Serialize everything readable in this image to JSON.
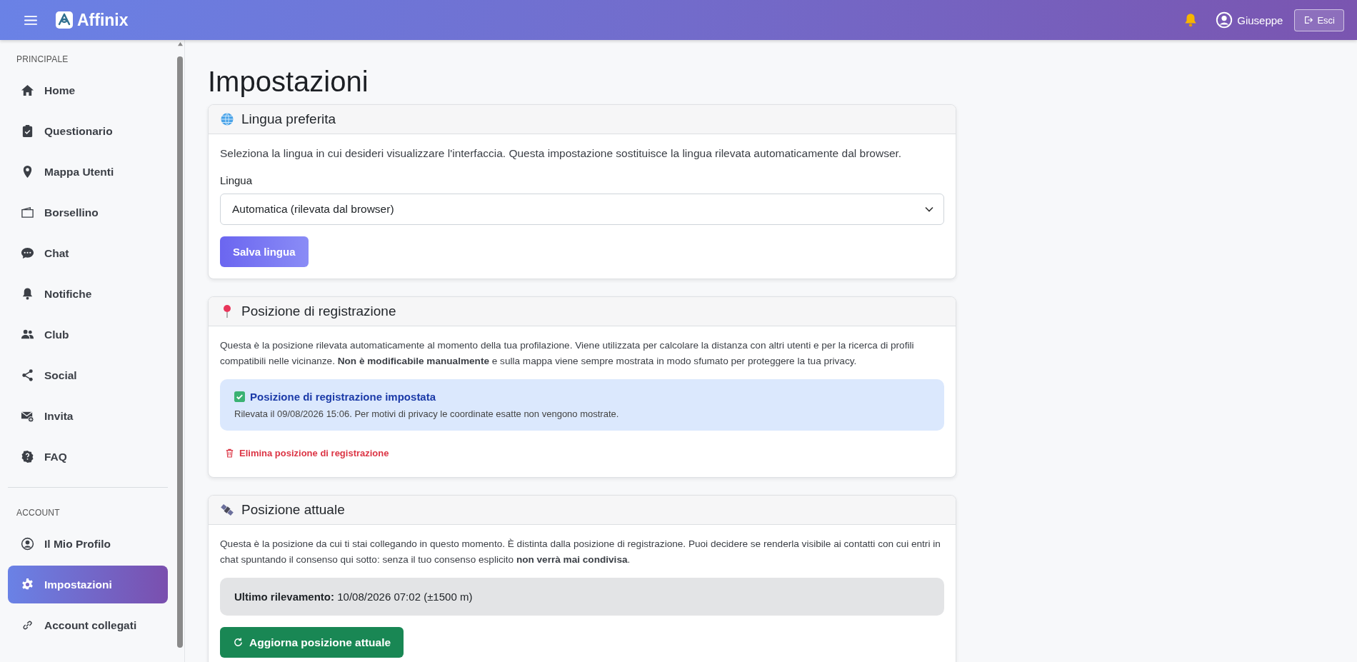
{
  "header": {
    "brand": "Affinix",
    "user": "Giuseppe",
    "logout": "Esci"
  },
  "sidebar": {
    "sections": [
      {
        "title": "PRINCIPALE",
        "items": [
          {
            "label": "Home",
            "selected": false
          },
          {
            "label": "Questionario",
            "selected": false
          },
          {
            "label": "Mappa Utenti",
            "selected": false
          },
          {
            "label": "Borsellino",
            "selected": false
          },
          {
            "label": "Chat",
            "selected": false
          },
          {
            "label": "Notifiche",
            "selected": false
          },
          {
            "label": "Club",
            "selected": false
          },
          {
            "label": "Social",
            "selected": false
          },
          {
            "label": "Invita",
            "selected": false
          },
          {
            "label": "FAQ",
            "selected": false
          }
        ]
      },
      {
        "title": "ACCOUNT",
        "items": [
          {
            "label": "Il Mio Profilo",
            "selected": false
          },
          {
            "label": "Impostazioni",
            "selected": true
          },
          {
            "label": "Account collegati",
            "selected": false
          }
        ]
      }
    ]
  },
  "page_title": "Impostazioni",
  "language_card": {
    "title": "Lingua preferita",
    "description": "Seleziona la lingua in cui desideri visualizzare l'interfaccia. Questa impostazione sostituisce la lingua rilevata automaticamente dal browser.",
    "field_label": "Lingua",
    "select_value": "Automatica (rilevata dal browser)",
    "button": "Salva lingua"
  },
  "registration_card": {
    "title": "Posizione di registrazione",
    "description": "Questa è la posizione rilevata automaticamente al momento della tua profilazione. Viene utilizzata per calcolare la distanza con altri utenti e per la ricerca di profili compatibili nelle vicinanze. **Non è modificabile manualmente** e sulla mappa viene sempre mostrata in modo sfumato per proteggere la tua privacy.",
    "alert_title": "Posizione di registrazione impostata",
    "alert_text": "Rilevata il 09/08/2026 15:06. Per motivi di privacy le coordinate esatte non vengono mostrate.",
    "delete_link": "Elimina posizione di registrazione"
  },
  "current_card": {
    "title": "Posizione attuale",
    "description": "Questa è la posizione da cui ti stai collegando in questo momento. È distinta dalla posizione di registrazione. Puoi decidere se renderla visibile ai contatti con cui entri in chat spuntando il consenso qui sotto: senza il tuo consenso esplicito **non verrà mai condivisa**.",
    "last_reading": "**Ultimo rilevamento:** 10/08/2026 07:02 (±1500 m)",
    "button": "Aggiorna posizione attuale"
  }
}
